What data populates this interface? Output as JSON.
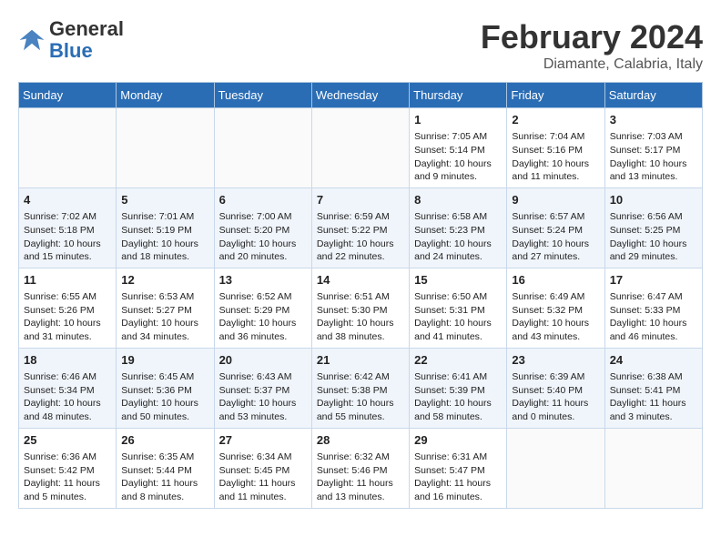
{
  "header": {
    "logo_general": "General",
    "logo_blue": "Blue",
    "month": "February 2024",
    "location": "Diamante, Calabria, Italy"
  },
  "days_of_week": [
    "Sunday",
    "Monday",
    "Tuesday",
    "Wednesday",
    "Thursday",
    "Friday",
    "Saturday"
  ],
  "weeks": [
    [
      {
        "day": "",
        "info": ""
      },
      {
        "day": "",
        "info": ""
      },
      {
        "day": "",
        "info": ""
      },
      {
        "day": "",
        "info": ""
      },
      {
        "day": "1",
        "info": "Sunrise: 7:05 AM\nSunset: 5:14 PM\nDaylight: 10 hours\nand 9 minutes."
      },
      {
        "day": "2",
        "info": "Sunrise: 7:04 AM\nSunset: 5:16 PM\nDaylight: 10 hours\nand 11 minutes."
      },
      {
        "day": "3",
        "info": "Sunrise: 7:03 AM\nSunset: 5:17 PM\nDaylight: 10 hours\nand 13 minutes."
      }
    ],
    [
      {
        "day": "4",
        "info": "Sunrise: 7:02 AM\nSunset: 5:18 PM\nDaylight: 10 hours\nand 15 minutes."
      },
      {
        "day": "5",
        "info": "Sunrise: 7:01 AM\nSunset: 5:19 PM\nDaylight: 10 hours\nand 18 minutes."
      },
      {
        "day": "6",
        "info": "Sunrise: 7:00 AM\nSunset: 5:20 PM\nDaylight: 10 hours\nand 20 minutes."
      },
      {
        "day": "7",
        "info": "Sunrise: 6:59 AM\nSunset: 5:22 PM\nDaylight: 10 hours\nand 22 minutes."
      },
      {
        "day": "8",
        "info": "Sunrise: 6:58 AM\nSunset: 5:23 PM\nDaylight: 10 hours\nand 24 minutes."
      },
      {
        "day": "9",
        "info": "Sunrise: 6:57 AM\nSunset: 5:24 PM\nDaylight: 10 hours\nand 27 minutes."
      },
      {
        "day": "10",
        "info": "Sunrise: 6:56 AM\nSunset: 5:25 PM\nDaylight: 10 hours\nand 29 minutes."
      }
    ],
    [
      {
        "day": "11",
        "info": "Sunrise: 6:55 AM\nSunset: 5:26 PM\nDaylight: 10 hours\nand 31 minutes."
      },
      {
        "day": "12",
        "info": "Sunrise: 6:53 AM\nSunset: 5:27 PM\nDaylight: 10 hours\nand 34 minutes."
      },
      {
        "day": "13",
        "info": "Sunrise: 6:52 AM\nSunset: 5:29 PM\nDaylight: 10 hours\nand 36 minutes."
      },
      {
        "day": "14",
        "info": "Sunrise: 6:51 AM\nSunset: 5:30 PM\nDaylight: 10 hours\nand 38 minutes."
      },
      {
        "day": "15",
        "info": "Sunrise: 6:50 AM\nSunset: 5:31 PM\nDaylight: 10 hours\nand 41 minutes."
      },
      {
        "day": "16",
        "info": "Sunrise: 6:49 AM\nSunset: 5:32 PM\nDaylight: 10 hours\nand 43 minutes."
      },
      {
        "day": "17",
        "info": "Sunrise: 6:47 AM\nSunset: 5:33 PM\nDaylight: 10 hours\nand 46 minutes."
      }
    ],
    [
      {
        "day": "18",
        "info": "Sunrise: 6:46 AM\nSunset: 5:34 PM\nDaylight: 10 hours\nand 48 minutes."
      },
      {
        "day": "19",
        "info": "Sunrise: 6:45 AM\nSunset: 5:36 PM\nDaylight: 10 hours\nand 50 minutes."
      },
      {
        "day": "20",
        "info": "Sunrise: 6:43 AM\nSunset: 5:37 PM\nDaylight: 10 hours\nand 53 minutes."
      },
      {
        "day": "21",
        "info": "Sunrise: 6:42 AM\nSunset: 5:38 PM\nDaylight: 10 hours\nand 55 minutes."
      },
      {
        "day": "22",
        "info": "Sunrise: 6:41 AM\nSunset: 5:39 PM\nDaylight: 10 hours\nand 58 minutes."
      },
      {
        "day": "23",
        "info": "Sunrise: 6:39 AM\nSunset: 5:40 PM\nDaylight: 11 hours\nand 0 minutes."
      },
      {
        "day": "24",
        "info": "Sunrise: 6:38 AM\nSunset: 5:41 PM\nDaylight: 11 hours\nand 3 minutes."
      }
    ],
    [
      {
        "day": "25",
        "info": "Sunrise: 6:36 AM\nSunset: 5:42 PM\nDaylight: 11 hours\nand 5 minutes."
      },
      {
        "day": "26",
        "info": "Sunrise: 6:35 AM\nSunset: 5:44 PM\nDaylight: 11 hours\nand 8 minutes."
      },
      {
        "day": "27",
        "info": "Sunrise: 6:34 AM\nSunset: 5:45 PM\nDaylight: 11 hours\nand 11 minutes."
      },
      {
        "day": "28",
        "info": "Sunrise: 6:32 AM\nSunset: 5:46 PM\nDaylight: 11 hours\nand 13 minutes."
      },
      {
        "day": "29",
        "info": "Sunrise: 6:31 AM\nSunset: 5:47 PM\nDaylight: 11 hours\nand 16 minutes."
      },
      {
        "day": "",
        "info": ""
      },
      {
        "day": "",
        "info": ""
      }
    ]
  ]
}
